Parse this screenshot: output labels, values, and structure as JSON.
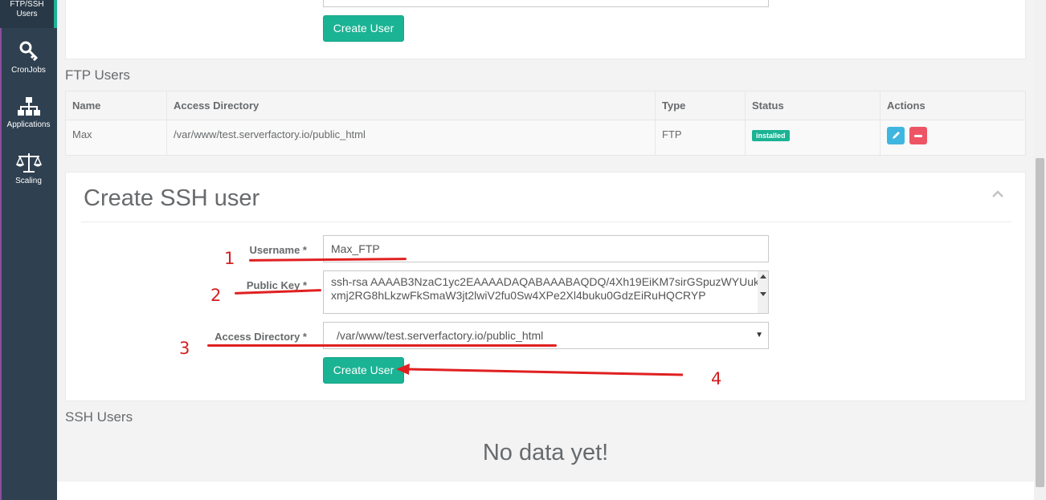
{
  "sidebar": {
    "items": [
      {
        "label_line1": "FTP/SSH",
        "label_line2": "Users",
        "icon": "users-icon"
      },
      {
        "label": "CronJobs",
        "icon": "key-icon"
      },
      {
        "label": "Applications",
        "icon": "sitemap-icon"
      },
      {
        "label": "Scaling",
        "icon": "balance-scale-icon"
      }
    ]
  },
  "top_panel": {
    "button_label": "Create User"
  },
  "ftp_users": {
    "title": "FTP Users",
    "columns": [
      "Name",
      "Access Directory",
      "Type",
      "Status",
      "Actions"
    ],
    "rows": [
      {
        "name": "Max",
        "directory": "/var/www/test.serverfactory.io/public_html",
        "type": "FTP",
        "status": "installed"
      }
    ]
  },
  "ssh_form": {
    "title": "Create SSH user",
    "username_label": "Username *",
    "username_value": "Max_FTP",
    "public_key_label": "Public Key *",
    "public_key_value": "ssh-rsa AAAAB3NzaC1yc2EAAAADAQABAAABAQDQ/4Xh19EiKM7sirGSpuzWYUukxmj2RG8hLkzwFkSmaW3jt2lwiV2fu0Sw4XPe2Xl4buku0GdzEiRuHQCRYP",
    "access_directory_label": "Access Directory *",
    "access_directory_value": "/var/www/test.serverfactory.io/public_html",
    "submit_label": "Create User"
  },
  "ssh_users": {
    "title": "SSH Users",
    "empty_text": "No data yet!"
  },
  "annotations": [
    "1",
    "2",
    "3",
    "4"
  ],
  "colors": {
    "sidebar_bg": "#2f4050",
    "accent": "#1ab394",
    "danger": "#ed5565",
    "annotation_red": "#e02020"
  }
}
